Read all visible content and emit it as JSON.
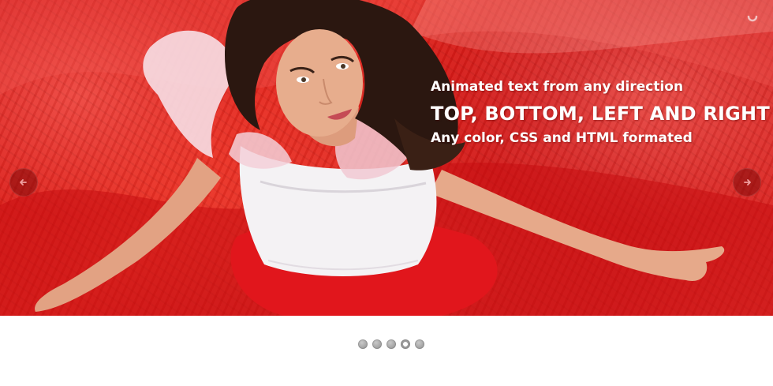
{
  "slider": {
    "captions": {
      "line1": "Animated text from any direction",
      "line2": "TOP, BOTTOM, LEFT AND RIGHT",
      "line3": "Any color, CSS and HTML formated"
    },
    "prev_icon": "arrow-left-icon",
    "next_icon": "arrow-right-icon",
    "loader_icon": "loading-spinner-icon",
    "bullets": {
      "count": 5,
      "active_index": 3
    },
    "colors": {
      "accent": "#d61a1a",
      "bullet": "#a7a7a7"
    }
  }
}
